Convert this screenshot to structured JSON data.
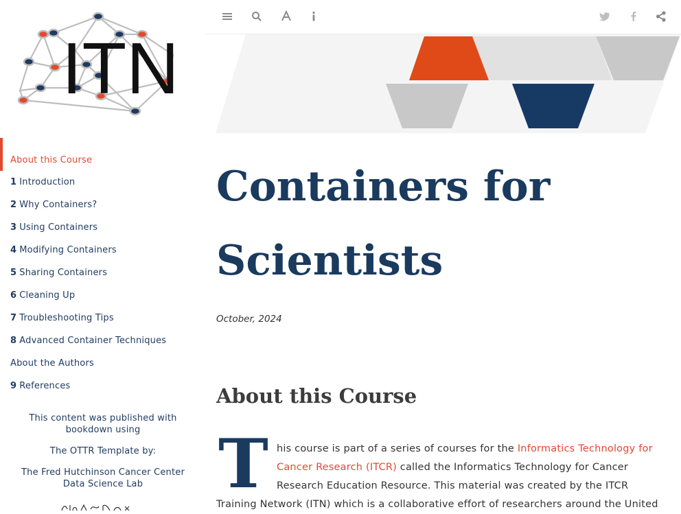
{
  "sidebar": {
    "logo_text": "ITN",
    "toc": [
      {
        "num": "",
        "label": "About this Course",
        "active": true
      },
      {
        "num": "1",
        "label": "Introduction"
      },
      {
        "num": "2",
        "label": "Why Containers?"
      },
      {
        "num": "3",
        "label": "Using Containers"
      },
      {
        "num": "4",
        "label": "Modifying Containers"
      },
      {
        "num": "5",
        "label": "Sharing Containers"
      },
      {
        "num": "6",
        "label": "Cleaning Up"
      },
      {
        "num": "7",
        "label": "Troubleshooting Tips"
      },
      {
        "num": "8",
        "label": "Advanced Container Techniques"
      },
      {
        "num": "",
        "label": "About the Authors"
      },
      {
        "num": "9",
        "label": "References"
      }
    ],
    "published_note": "This content was published with bookdown using",
    "ottr_note": "The OTTR Template by:",
    "fh_note": "The Fred Hutchinson Cancer Center Data Science Lab"
  },
  "toolbar": {
    "icons": [
      "menu-icon",
      "search-icon",
      "font-settings-icon",
      "info-icon",
      "twitter-icon",
      "facebook-icon",
      "share-icon"
    ]
  },
  "main": {
    "title": "Containers for Scientists",
    "date": "October, 2024",
    "section_title": "About this Course",
    "dropcap": "T",
    "para": {
      "line1_pre": "his course is part of a series of courses for the ",
      "link_line1": "Informatics Technology for",
      "link_line2": "Cancer Research (ITCR)",
      "line2_post": " called the Informatics Technology for Cancer",
      "line3": "Research Education Resource. This material was created by the ITCR",
      "line4": "Training Network (ITN) which is a collaborative effort of researchers around the United"
    }
  },
  "colors": {
    "accent": "#e2492f",
    "navy": "#1a3a5e",
    "banner_gray": "#c8c8c8",
    "banner_light": "#e1e1e1"
  }
}
